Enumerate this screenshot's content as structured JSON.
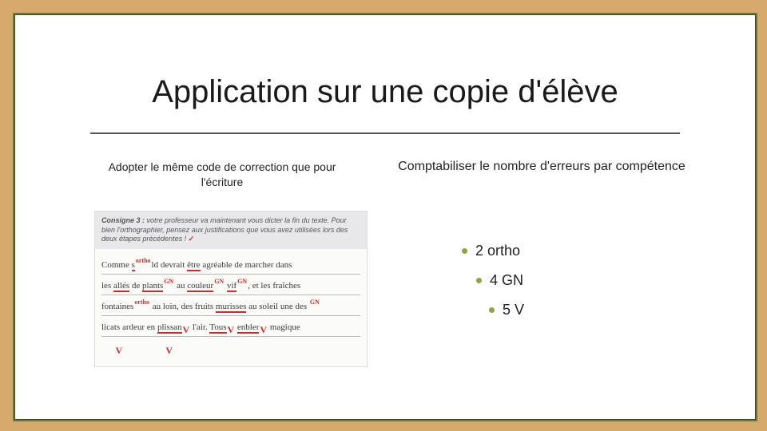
{
  "title": "Application sur une copie d'élève",
  "left_subtitle": "Adopter le même code de correction que pour l'écriture",
  "right_subtitle": "Comptabiliser le nombre d'erreurs par compétence",
  "sample": {
    "instruction_label": "Consigne 3 :",
    "instruction_text": "votre professeur va maintenant vous dicter la fin du texte. Pour bien l'orthographier, pensez aux justifications que vous avez utilisées lors des deux étapes précédentes !",
    "lines": [
      "Comme s'il devrait être agréable de marcher dans",
      "les allés de plants au couleur vif, et les fraîches",
      "fontaines au loin, des fruits murisses au soleil une des",
      "licats ardeur en plissan l'air. Tous enbler magique"
    ]
  },
  "errors": [
    {
      "count": 2,
      "label": "ortho"
    },
    {
      "count": 4,
      "label": "GN"
    },
    {
      "count": 5,
      "label": "V"
    }
  ],
  "marks": {
    "gn": "GN",
    "ortho": "ortho",
    "v": "V",
    "check": "✓"
  }
}
